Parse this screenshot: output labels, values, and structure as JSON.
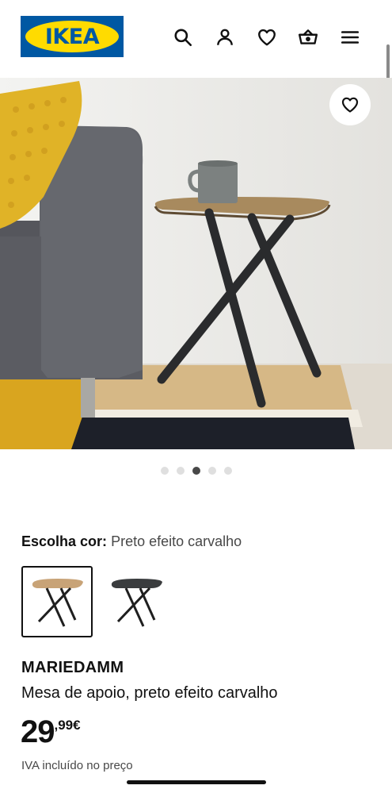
{
  "brand": {
    "logo_text": "IKEA"
  },
  "header_icons": [
    "search-icon",
    "user-icon",
    "heart-icon",
    "cart-icon",
    "menu-icon"
  ],
  "gallery": {
    "image_count": 5,
    "active_index": 3
  },
  "color_choice": {
    "label": "Escolha cor:",
    "selected": "Preto efeito carvalho"
  },
  "product": {
    "name": "MARIEDAMM",
    "description": "Mesa de apoio, preto efeito carvalho",
    "price_whole": "29",
    "price_decimal": ",99€",
    "vat_note": "IVA incluído no preço"
  },
  "colors": {
    "brand_blue": "#0058a3",
    "brand_yellow": "#ffdb00"
  }
}
